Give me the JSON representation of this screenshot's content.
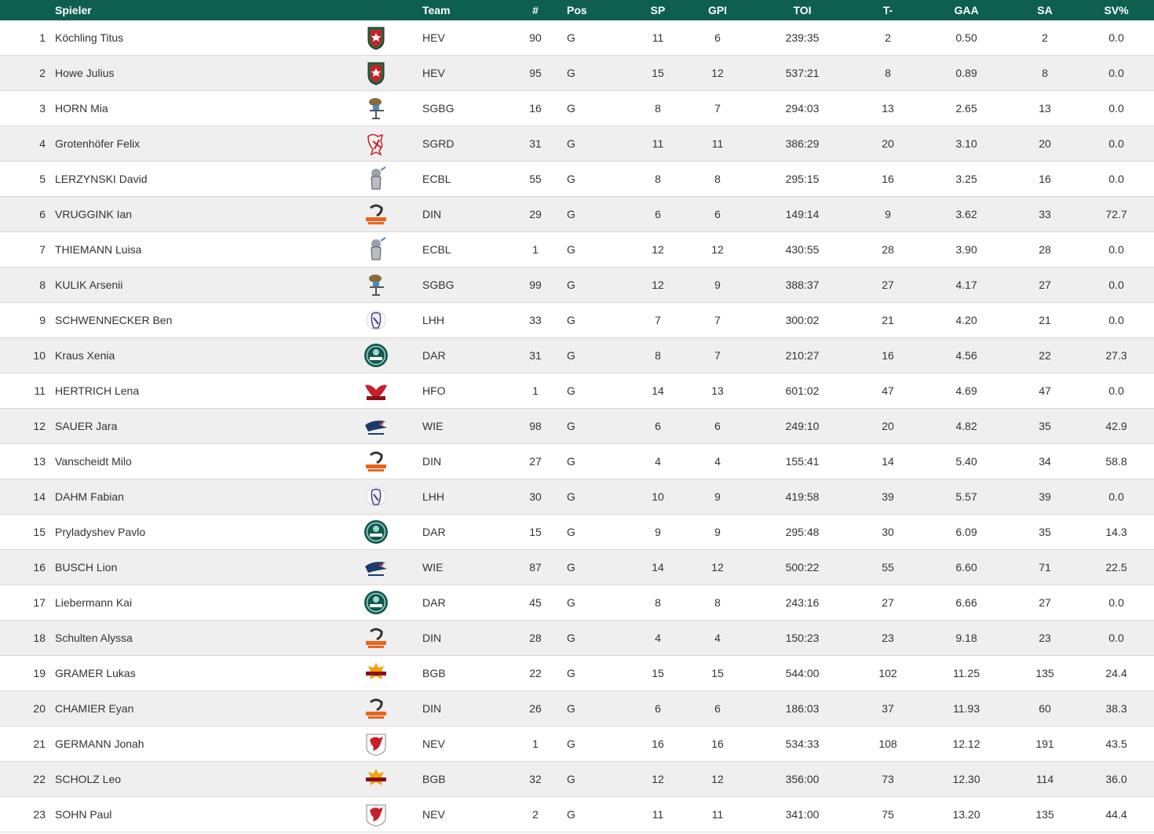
{
  "headers": {
    "player": "Spieler",
    "team": "Team",
    "number": "#",
    "position": "Pos",
    "sp": "SP",
    "gpi": "GPI",
    "toi": "TOI",
    "ga": "T-",
    "gaa": "GAA",
    "sa": "SA",
    "svp": "SV%"
  },
  "colors": {
    "header_bg": "#0f5f4f",
    "header_text": "#ffffff",
    "row_alt_bg": "#efefef",
    "row_border": "#d9d9d9"
  },
  "team_logos": {
    "HEV": "shield-crest-icon",
    "SGBG": "stickman-mascot-icon",
    "SGRD": "red-mascot-icon",
    "ECBL": "gray-mascot-icon",
    "DIN": "orange-wordmark-icon",
    "LHH": "polar-bear-icon",
    "DAR": "round-dukes-badge-icon",
    "HFO": "red-wings-icon",
    "WIE": "eagle-icon",
    "BGB": "gold-wordmark-icon",
    "NEV": "red-bird-crest-icon"
  },
  "rows": [
    {
      "rank": "1",
      "player": "Köchling Titus",
      "team": "HEV",
      "number": "90",
      "pos": "G",
      "sp": "11",
      "gpi": "6",
      "toi": "239:35",
      "ga": "2",
      "gaa": "0.50",
      "sa": "2",
      "svp": "0.0"
    },
    {
      "rank": "2",
      "player": "Howe Julius",
      "team": "HEV",
      "number": "95",
      "pos": "G",
      "sp": "15",
      "gpi": "12",
      "toi": "537:21",
      "ga": "8",
      "gaa": "0.89",
      "sa": "8",
      "svp": "0.0"
    },
    {
      "rank": "3",
      "player": "HORN Mia",
      "team": "SGBG",
      "number": "16",
      "pos": "G",
      "sp": "8",
      "gpi": "7",
      "toi": "294:03",
      "ga": "13",
      "gaa": "2.65",
      "sa": "13",
      "svp": "0.0"
    },
    {
      "rank": "4",
      "player": "Grotenhöfer Felix",
      "team": "SGRD",
      "number": "31",
      "pos": "G",
      "sp": "11",
      "gpi": "11",
      "toi": "386:29",
      "ga": "20",
      "gaa": "3.10",
      "sa": "20",
      "svp": "0.0"
    },
    {
      "rank": "5",
      "player": "LERZYNSKI David",
      "team": "ECBL",
      "number": "55",
      "pos": "G",
      "sp": "8",
      "gpi": "8",
      "toi": "295:15",
      "ga": "16",
      "gaa": "3.25",
      "sa": "16",
      "svp": "0.0"
    },
    {
      "rank": "6",
      "player": "VRUGGINK Ian",
      "team": "DIN",
      "number": "29",
      "pos": "G",
      "sp": "6",
      "gpi": "6",
      "toi": "149:14",
      "ga": "9",
      "gaa": "3.62",
      "sa": "33",
      "svp": "72.7"
    },
    {
      "rank": "7",
      "player": "THIEMANN Luisa",
      "team": "ECBL",
      "number": "1",
      "pos": "G",
      "sp": "12",
      "gpi": "12",
      "toi": "430:55",
      "ga": "28",
      "gaa": "3.90",
      "sa": "28",
      "svp": "0.0"
    },
    {
      "rank": "8",
      "player": "KULIK Arsenii",
      "team": "SGBG",
      "number": "99",
      "pos": "G",
      "sp": "12",
      "gpi": "9",
      "toi": "388:37",
      "ga": "27",
      "gaa": "4.17",
      "sa": "27",
      "svp": "0.0"
    },
    {
      "rank": "9",
      "player": "SCHWENNECKER Ben",
      "team": "LHH",
      "number": "33",
      "pos": "G",
      "sp": "7",
      "gpi": "7",
      "toi": "300:02",
      "ga": "21",
      "gaa": "4.20",
      "sa": "21",
      "svp": "0.0"
    },
    {
      "rank": "10",
      "player": "Kraus Xenia",
      "team": "DAR",
      "number": "31",
      "pos": "G",
      "sp": "8",
      "gpi": "7",
      "toi": "210:27",
      "ga": "16",
      "gaa": "4.56",
      "sa": "22",
      "svp": "27.3"
    },
    {
      "rank": "11",
      "player": "HERTRICH Lena",
      "team": "HFO",
      "number": "1",
      "pos": "G",
      "sp": "14",
      "gpi": "13",
      "toi": "601:02",
      "ga": "47",
      "gaa": "4.69",
      "sa": "47",
      "svp": "0.0"
    },
    {
      "rank": "12",
      "player": "SAUER Jara",
      "team": "WIE",
      "number": "98",
      "pos": "G",
      "sp": "6",
      "gpi": "6",
      "toi": "249:10",
      "ga": "20",
      "gaa": "4.82",
      "sa": "35",
      "svp": "42.9"
    },
    {
      "rank": "13",
      "player": "Vanscheidt Milo",
      "team": "DIN",
      "number": "27",
      "pos": "G",
      "sp": "4",
      "gpi": "4",
      "toi": "155:41",
      "ga": "14",
      "gaa": "5.40",
      "sa": "34",
      "svp": "58.8"
    },
    {
      "rank": "14",
      "player": "DAHM Fabian",
      "team": "LHH",
      "number": "30",
      "pos": "G",
      "sp": "10",
      "gpi": "9",
      "toi": "419:58",
      "ga": "39",
      "gaa": "5.57",
      "sa": "39",
      "svp": "0.0"
    },
    {
      "rank": "15",
      "player": "Pryladyshev Pavlo",
      "team": "DAR",
      "number": "15",
      "pos": "G",
      "sp": "9",
      "gpi": "9",
      "toi": "295:48",
      "ga": "30",
      "gaa": "6.09",
      "sa": "35",
      "svp": "14.3"
    },
    {
      "rank": "16",
      "player": "BUSCH Lion",
      "team": "WIE",
      "number": "87",
      "pos": "G",
      "sp": "14",
      "gpi": "12",
      "toi": "500:22",
      "ga": "55",
      "gaa": "6.60",
      "sa": "71",
      "svp": "22.5"
    },
    {
      "rank": "17",
      "player": "Liebermann Kai",
      "team": "DAR",
      "number": "45",
      "pos": "G",
      "sp": "8",
      "gpi": "8",
      "toi": "243:16",
      "ga": "27",
      "gaa": "6.66",
      "sa": "27",
      "svp": "0.0"
    },
    {
      "rank": "18",
      "player": "Schulten Alyssa",
      "team": "DIN",
      "number": "28",
      "pos": "G",
      "sp": "4",
      "gpi": "4",
      "toi": "150:23",
      "ga": "23",
      "gaa": "9.18",
      "sa": "23",
      "svp": "0.0"
    },
    {
      "rank": "19",
      "player": "GRAMER Lukas",
      "team": "BGB",
      "number": "22",
      "pos": "G",
      "sp": "15",
      "gpi": "15",
      "toi": "544:00",
      "ga": "102",
      "gaa": "11.25",
      "sa": "135",
      "svp": "24.4"
    },
    {
      "rank": "20",
      "player": "CHAMIER Eyan",
      "team": "DIN",
      "number": "26",
      "pos": "G",
      "sp": "6",
      "gpi": "6",
      "toi": "186:03",
      "ga": "37",
      "gaa": "11.93",
      "sa": "60",
      "svp": "38.3"
    },
    {
      "rank": "21",
      "player": "GERMANN Jonah",
      "team": "NEV",
      "number": "1",
      "pos": "G",
      "sp": "16",
      "gpi": "16",
      "toi": "534:33",
      "ga": "108",
      "gaa": "12.12",
      "sa": "191",
      "svp": "43.5"
    },
    {
      "rank": "22",
      "player": "SCHOLZ Leo",
      "team": "BGB",
      "number": "32",
      "pos": "G",
      "sp": "12",
      "gpi": "12",
      "toi": "356:00",
      "ga": "73",
      "gaa": "12.30",
      "sa": "114",
      "svp": "36.0"
    },
    {
      "rank": "23",
      "player": "SOHN Paul",
      "team": "NEV",
      "number": "2",
      "pos": "G",
      "sp": "11",
      "gpi": "11",
      "toi": "341:00",
      "ga": "75",
      "gaa": "13.20",
      "sa": "135",
      "svp": "44.4"
    }
  ]
}
